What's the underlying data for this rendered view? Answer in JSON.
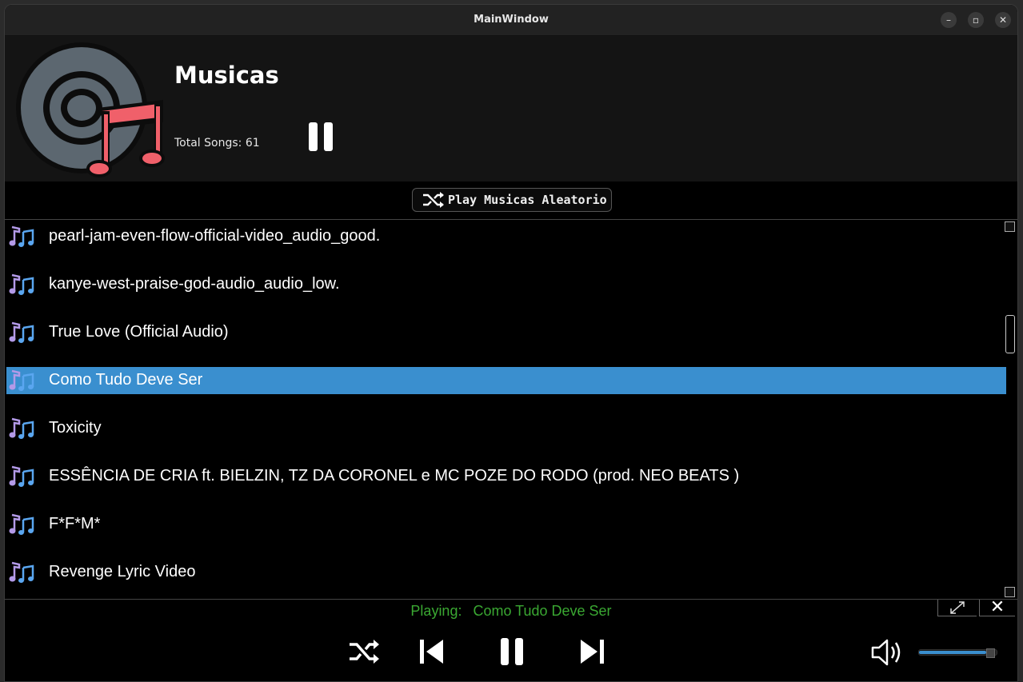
{
  "window": {
    "title": "MainWindow"
  },
  "header": {
    "playlist_title": "Musicas",
    "total_songs": "Total Songs: 61"
  },
  "shuffle_button": {
    "label": "Play Musicas Aleatorio"
  },
  "songs": [
    {
      "title": "pearl-jam-even-flow-official-video_audio_good."
    },
    {
      "title": "kanye-west-praise-god-audio_audio_low."
    },
    {
      "title": "True Love (Official Audio)"
    },
    {
      "title": "Como Tudo Deve Ser",
      "selected": true
    },
    {
      "title": "Toxicity"
    },
    {
      "title": "ESSÊNCIA DE CRIA ft. BIELZIN, TZ DA CORONEL e MC POZE DO RODO (prod. NEO BEATS )"
    },
    {
      "title": "F*F*M*"
    },
    {
      "title": "Revenge Lyric Video"
    }
  ],
  "now_playing": {
    "label": "Playing:",
    "track": "Como Tudo Deve Ser"
  },
  "volume": {
    "level": 0.87
  },
  "colors": {
    "accent": "#3a8fcf",
    "playing_text": "#3aa832",
    "note_icon": "#b39ae8"
  }
}
